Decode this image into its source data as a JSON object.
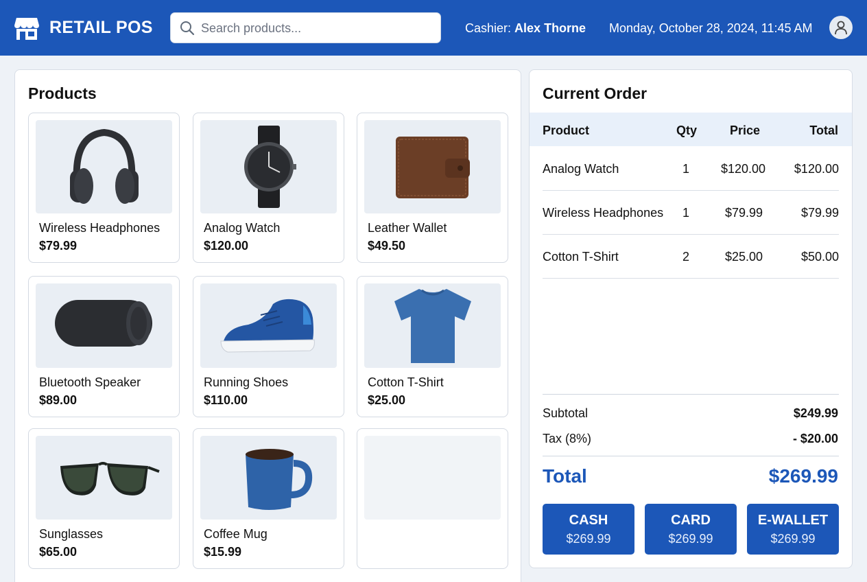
{
  "header": {
    "brand_title": "RETAIL POS",
    "search_placeholder": "Search products...",
    "cashier_label": "Cashier:",
    "cashier_name": "Alex Thorne",
    "datetime": "Monday, October 28, 2024, 11:45 AM",
    "brand_color": "#1c57b8"
  },
  "products": {
    "title": "Products",
    "items": [
      {
        "name": "Wireless Headphones",
        "price": "$79.99",
        "icon": "headphones-image"
      },
      {
        "name": "Analog Watch",
        "price": "$120.00",
        "icon": "watch-image"
      },
      {
        "name": "Leather Wallet",
        "price": "$49.50",
        "icon": "wallet-image"
      },
      {
        "name": "Bluetooth Speaker",
        "price": "$89.00",
        "icon": "speaker-image"
      },
      {
        "name": "Running Shoes",
        "price": "$110.00",
        "icon": "shoe-image"
      },
      {
        "name": "Cotton T-Shirt",
        "price": "$25.00",
        "icon": "tshirt-image"
      },
      {
        "name": "Sunglasses",
        "price": "$65.00",
        "icon": "sunglasses-image"
      },
      {
        "name": "Coffee Mug",
        "price": "$15.99",
        "icon": "mug-image"
      }
    ]
  },
  "order": {
    "title": "Current Order",
    "columns": {
      "product": "Product",
      "qty": "Qty",
      "price": "Price",
      "total": "Total"
    },
    "rows": [
      {
        "product": "Analog Watch",
        "qty": "1",
        "price": "$120.00",
        "total": "$120.00"
      },
      {
        "product": "Wireless Headphones",
        "qty": "1",
        "price": "$79.99",
        "total": "$79.99"
      },
      {
        "product": "Cotton T-Shirt",
        "qty": "2",
        "price": "$25.00",
        "total": "$50.00"
      }
    ],
    "subtotal_label": "Subtotal",
    "subtotal_value": "$249.99",
    "tax_label": "Tax (8%)",
    "tax_value": "- $20.00",
    "total_label": "Total",
    "total_value": "$269.99",
    "payments": [
      {
        "label": "CASH",
        "amount": "$269.99"
      },
      {
        "label": "CARD",
        "amount": "$269.99"
      },
      {
        "label": "E-WALLET",
        "amount": "$269.99"
      }
    ]
  }
}
